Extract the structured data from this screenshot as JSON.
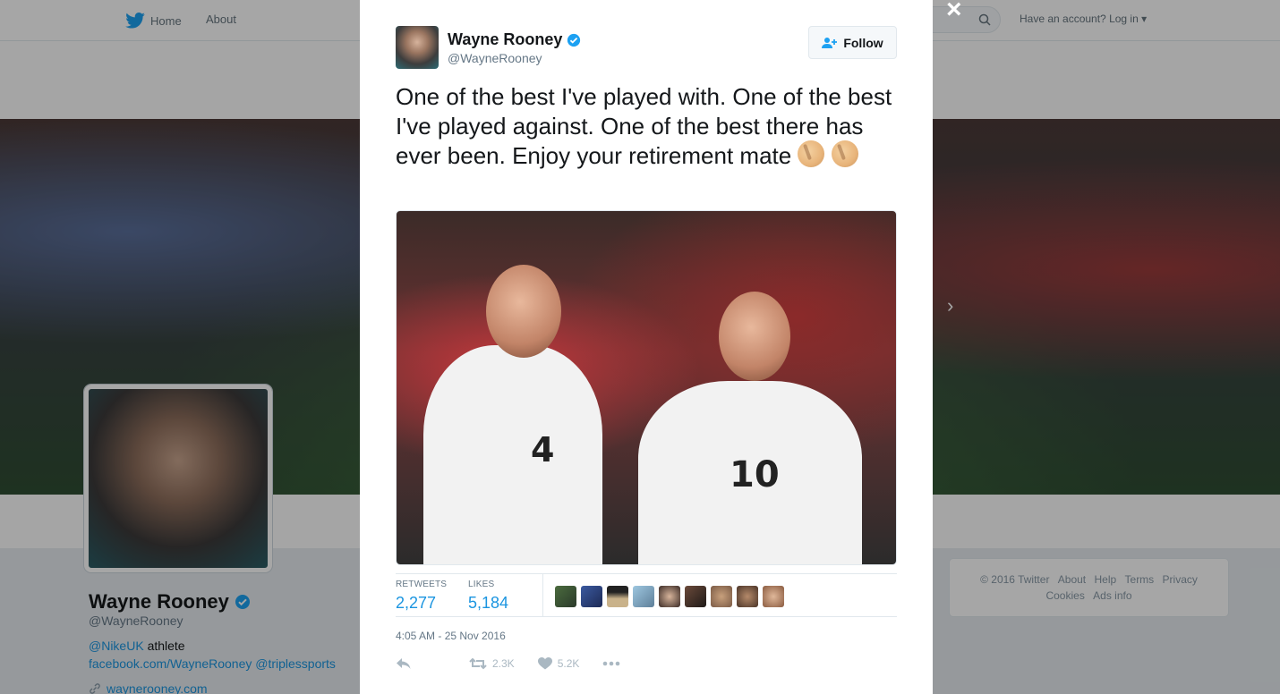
{
  "nav": {
    "home_label": "Home",
    "about_label": "About",
    "login_label": "Have an account? Log in"
  },
  "profile": {
    "name": "Wayne Rooney",
    "handle": "@WayneRooney",
    "bio_mention": "@NikeUK",
    "bio_text": "athlete",
    "bio_line2_link": "facebook.com/WayneRooney",
    "bio_line2_mention": "@triplessports",
    "url": "waynerooney.com"
  },
  "footer": {
    "copyright": "© 2016 Twitter",
    "about": "About",
    "help": "Help",
    "terms": "Terms",
    "privacy": "Privacy",
    "cookies": "Cookies",
    "ads_info": "Ads info"
  },
  "tweet": {
    "author_name": "Wayne Rooney",
    "author_handle": "@WayneRooney",
    "follow_label": "Follow",
    "text": "One of the best I've played with. One of the best I've played against. One of the best there has ever been. Enjoy your retirement mate",
    "retweets_label": "RETWEETS",
    "retweets_value": "2,277",
    "likes_label": "LIKES",
    "likes_value": "5,184",
    "timestamp": "4:05 AM - 25 Nov 2016",
    "action_retweet_count": "2.3K",
    "action_like_count": "5.2K",
    "media_numbers": {
      "left_player": "4",
      "right_player": "10"
    }
  },
  "colors": {
    "brand": "#1da1f2",
    "link": "#1b95e0",
    "overlay": "rgba(0,0,0,0.35)"
  },
  "icons": [
    "twitter-bird-icon",
    "search-icon",
    "verified-icon",
    "follow-person-icon",
    "close-icon",
    "reply-icon",
    "retweet-icon",
    "heart-icon",
    "more-icon",
    "link-icon",
    "chevron-right-icon"
  ]
}
